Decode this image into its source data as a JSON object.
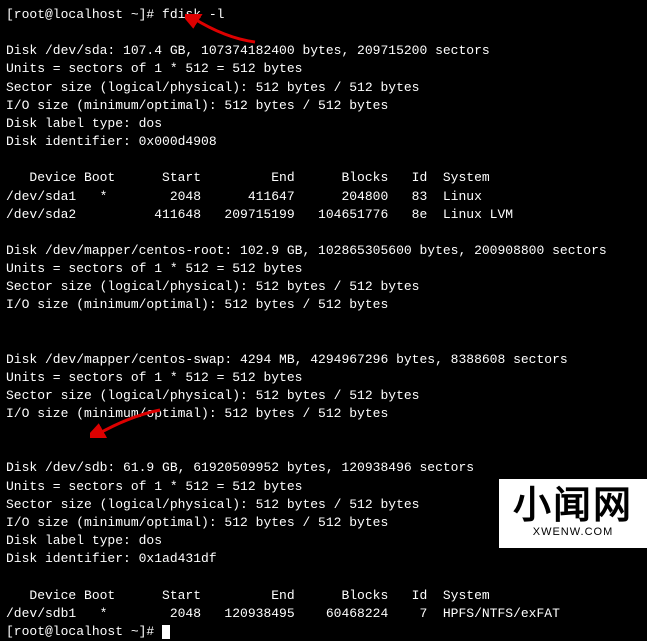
{
  "prompt1": "[root@localhost ~]# fdisk -l",
  "sda": {
    "l1": "Disk /dev/sda: 107.4 GB, 107374182400 bytes, 209715200 sectors",
    "l2": "Units = sectors of 1 * 512 = 512 bytes",
    "l3": "Sector size (logical/physical): 512 bytes / 512 bytes",
    "l4": "I/O size (minimum/optimal): 512 bytes / 512 bytes",
    "l5": "Disk label type: dos",
    "l6": "Disk identifier: 0x000d4908",
    "hdr": "   Device Boot      Start         End      Blocks   Id  System",
    "r1": "/dev/sda1   *        2048      411647      204800   83  Linux",
    "r2": "/dev/sda2          411648   209715199   104651776   8e  Linux LVM"
  },
  "root": {
    "l1": "Disk /dev/mapper/centos-root: 102.9 GB, 102865305600 bytes, 200908800 sectors",
    "l2": "Units = sectors of 1 * 512 = 512 bytes",
    "l3": "Sector size (logical/physical): 512 bytes / 512 bytes",
    "l4": "I/O size (minimum/optimal): 512 bytes / 512 bytes"
  },
  "swap": {
    "l1": "Disk /dev/mapper/centos-swap: 4294 MB, 4294967296 bytes, 8388608 sectors",
    "l2": "Units = sectors of 1 * 512 = 512 bytes",
    "l3": "Sector size (logical/physical): 512 bytes / 512 bytes",
    "l4": "I/O size (minimum/optimal): 512 bytes / 512 bytes"
  },
  "sdb": {
    "l1": "Disk /dev/sdb: 61.9 GB, 61920509952 bytes, 120938496 sectors",
    "l2": "Units = sectors of 1 * 512 = 512 bytes",
    "l3": "Sector size (logical/physical): 512 bytes / 512 bytes",
    "l4": "I/O size (minimum/optimal): 512 bytes / 512 bytes",
    "l5": "Disk label type: dos",
    "l6": "Disk identifier: 0x1ad431df",
    "hdr": "   Device Boot      Start         End      Blocks   Id  System",
    "r1": "/dev/sdb1   *        2048   120938495    60468224    7  HPFS/NTFS/exFAT"
  },
  "prompt2": "[root@localhost ~]# ",
  "watermark": {
    "main": "小闻网",
    "sub": "XWENW.COM"
  }
}
